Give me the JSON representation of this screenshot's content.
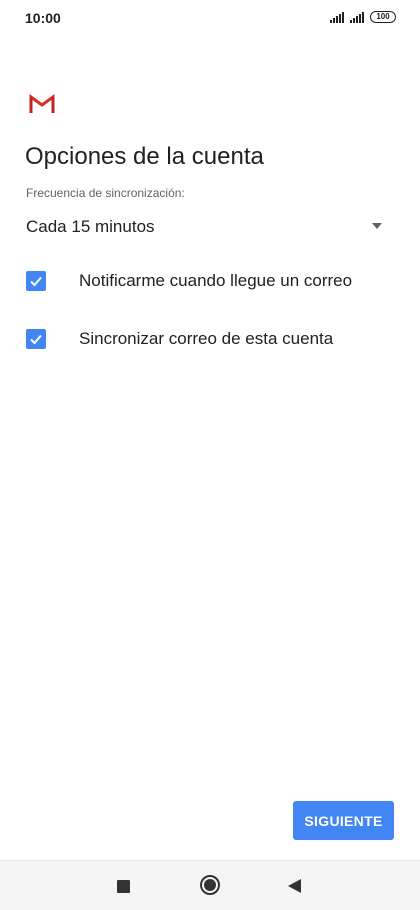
{
  "status_bar": {
    "time": "10:00",
    "battery": "100",
    "icons": [
      "signal-icon",
      "signal-icon",
      "battery-icon"
    ]
  },
  "app": {
    "logo": "gmail-logo-icon",
    "brand_color": "#D93025"
  },
  "main": {
    "title": "Opciones de la cuenta",
    "frequency": {
      "label": "Frecuencia de sincronización:",
      "value": "Cada 15 minutos",
      "icon": "dropdown-arrow-icon"
    },
    "options": [
      {
        "label": "Notificarme cuando llegue un correo",
        "checked": true
      },
      {
        "label": "Sincronizar correo de esta cuenta",
        "checked": true
      }
    ],
    "next_button": "SIGUIENTE",
    "accent_color": "#4285F4"
  },
  "nav_bar": {
    "icons": [
      "recent-apps-icon",
      "home-icon",
      "back-icon"
    ]
  }
}
